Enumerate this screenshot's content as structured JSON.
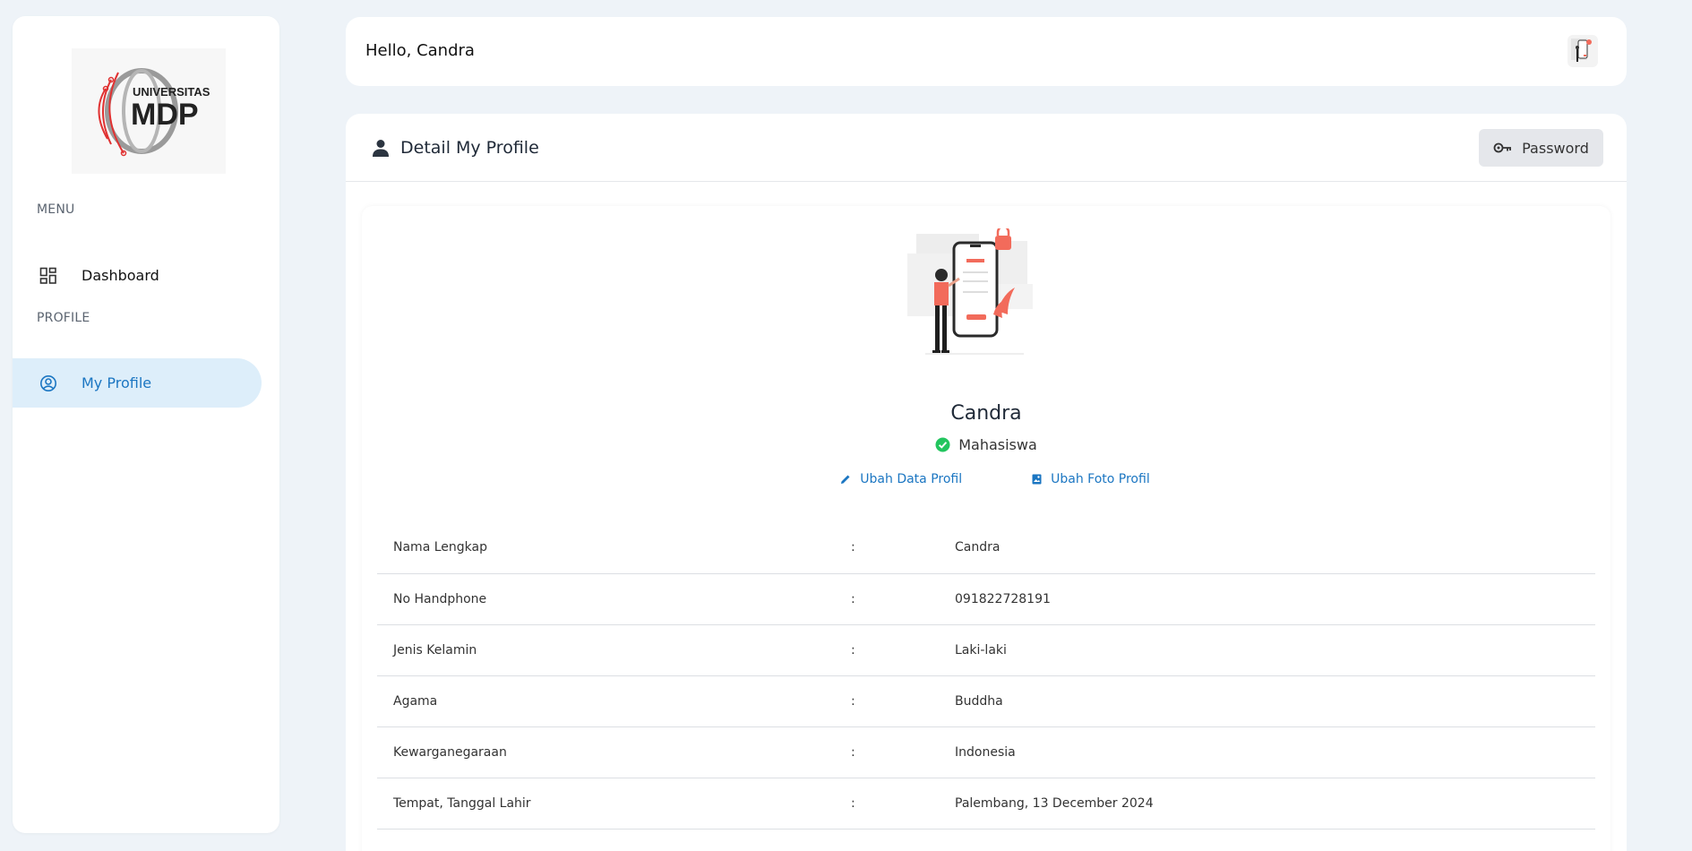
{
  "sidebar": {
    "logo": {
      "line1": "UNIVERSITAS",
      "line2": "MDP"
    },
    "sections": [
      {
        "label": "MENU",
        "items": [
          {
            "label": "Dashboard",
            "icon": "dashboard-icon"
          }
        ]
      },
      {
        "label": "PROFILE",
        "items": [
          {
            "label": "My Profile",
            "icon": "user-circle-icon",
            "active": true
          }
        ]
      }
    ]
  },
  "header": {
    "greeting": "Hello, Candra",
    "avatar_icon": "avatar-illustration"
  },
  "profile_card": {
    "title": "Detail My Profile",
    "title_icon": "person-icon",
    "password_button": {
      "label": "Password",
      "icon": "key-icon"
    },
    "name": "Candra",
    "role": "Mahasiswa",
    "role_icon": "check-circle-icon",
    "actions": [
      {
        "label": "Ubah Data Profil",
        "icon": "pencil-icon"
      },
      {
        "label": "Ubah Foto Profil",
        "icon": "image-icon"
      }
    ],
    "fields": [
      {
        "key": "Nama Lengkap",
        "sep": ":",
        "value": "Candra"
      },
      {
        "key": "No Handphone",
        "sep": ":",
        "value": "091822728191"
      },
      {
        "key": "Jenis Kelamin",
        "sep": ":",
        "value": "Laki-laki"
      },
      {
        "key": "Agama",
        "sep": ":",
        "value": "Buddha"
      },
      {
        "key": "Kewarganegaraan",
        "sep": ":",
        "value": "Indonesia"
      },
      {
        "key": "Tempat, Tanggal Lahir",
        "sep": ":",
        "value": "Palembang, 13 December 2024"
      }
    ]
  },
  "colors": {
    "background": "#eef3f8",
    "accent": "#1b76c2",
    "active_bg": "#ddeefa",
    "success": "#22c55e",
    "illustration_red": "#f26b5b"
  }
}
